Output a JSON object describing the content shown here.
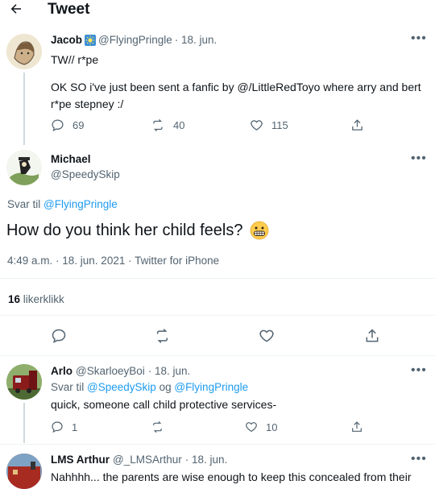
{
  "header": {
    "title": "Tweet"
  },
  "tweet1": {
    "name": "Jacob",
    "handle": "@FlyingPringle",
    "date": "· 18. jun.",
    "line1": "TW// r*pe",
    "line2": "OK SO i've just been sent a fanfic by @/LittleRedToyo  where arry and bert",
    "line3": "r*pe stepney :/",
    "replies": "69",
    "retweets": "40",
    "likes": "115"
  },
  "main": {
    "name": "Michael",
    "handle": "@SpeedySkip",
    "reply_prefix": "Svar til",
    "reply_to": "@FlyingPringle",
    "text": "How do you think her child feels?",
    "emoji": "grimacing-face",
    "meta": "4:49 a.m. · 18. jun. 2021 · Twitter for iPhone",
    "likes_count": "16",
    "likes_label": "likerklikk"
  },
  "reply1": {
    "name": "Arlo",
    "handle": "@SkarloeyBoi",
    "date": "· 18. jun.",
    "reply_prefix": "Svar til",
    "reply_to1": "@SpeedySkip",
    "reply_and": "og",
    "reply_to2": "@FlyingPringle",
    "text": "quick, someone call child protective services-",
    "replies": "1",
    "likes": "10"
  },
  "reply2": {
    "name": "LMS Arthur",
    "handle": "@_LMSArthur",
    "date": "· 18. jun.",
    "text": "Nahhhh... the parents are wise enough to keep this concealed from their"
  },
  "colors": {
    "accent": "#1d9bf0",
    "muted": "#536471",
    "divider": "#eff3f4"
  },
  "icons": [
    "back-arrow-icon",
    "more-icon",
    "reply-icon",
    "retweet-icon",
    "like-icon",
    "share-icon",
    "verified-sun-icon"
  ]
}
